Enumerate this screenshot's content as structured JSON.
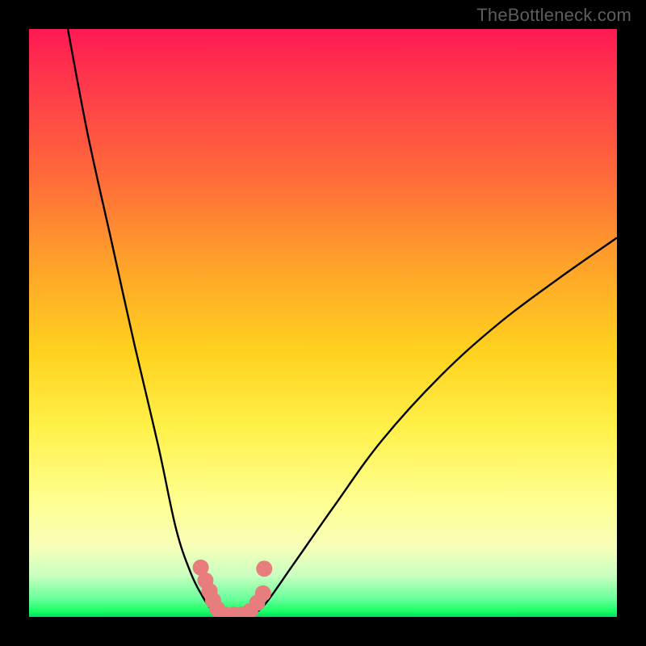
{
  "watermark": {
    "text": "TheBottleneck.com"
  },
  "colors": {
    "curve": "#000000",
    "markers": "#e77d7d",
    "frame": "#000000"
  },
  "chart_data": {
    "type": "line",
    "title": "",
    "xlabel": "",
    "ylabel": "",
    "xlim": [
      0,
      1
    ],
    "ylim": [
      0,
      1
    ],
    "legend": false,
    "grid": false,
    "series": [
      {
        "name": "left-branch",
        "x": [
          0.066,
          0.1,
          0.14,
          0.18,
          0.22,
          0.25,
          0.275,
          0.295,
          0.31,
          0.325
        ],
        "y": [
          1.0,
          0.82,
          0.64,
          0.46,
          0.29,
          0.15,
          0.075,
          0.035,
          0.013,
          0.003
        ]
      },
      {
        "name": "right-branch",
        "x": [
          0.375,
          0.4,
          0.45,
          0.52,
          0.6,
          0.7,
          0.8,
          0.9,
          1.0
        ],
        "y": [
          0.003,
          0.02,
          0.09,
          0.19,
          0.3,
          0.41,
          0.5,
          0.575,
          0.645
        ]
      }
    ],
    "markers": {
      "name": "highlighted-points",
      "shape": "circle",
      "color": "#e77d7d",
      "points": [
        {
          "x": 0.292,
          "y": 0.084,
          "r": 10
        },
        {
          "x": 0.3,
          "y": 0.062,
          "r": 10
        },
        {
          "x": 0.307,
          "y": 0.044,
          "r": 10
        },
        {
          "x": 0.313,
          "y": 0.028,
          "r": 10
        },
        {
          "x": 0.32,
          "y": 0.014,
          "r": 10
        },
        {
          "x": 0.332,
          "y": 0.004,
          "r": 10
        },
        {
          "x": 0.348,
          "y": 0.004,
          "r": 10
        },
        {
          "x": 0.362,
          "y": 0.004,
          "r": 10
        },
        {
          "x": 0.376,
          "y": 0.01,
          "r": 10
        },
        {
          "x": 0.388,
          "y": 0.024,
          "r": 10
        },
        {
          "x": 0.398,
          "y": 0.04,
          "r": 10
        },
        {
          "x": 0.4,
          "y": 0.082,
          "r": 10
        }
      ]
    }
  }
}
